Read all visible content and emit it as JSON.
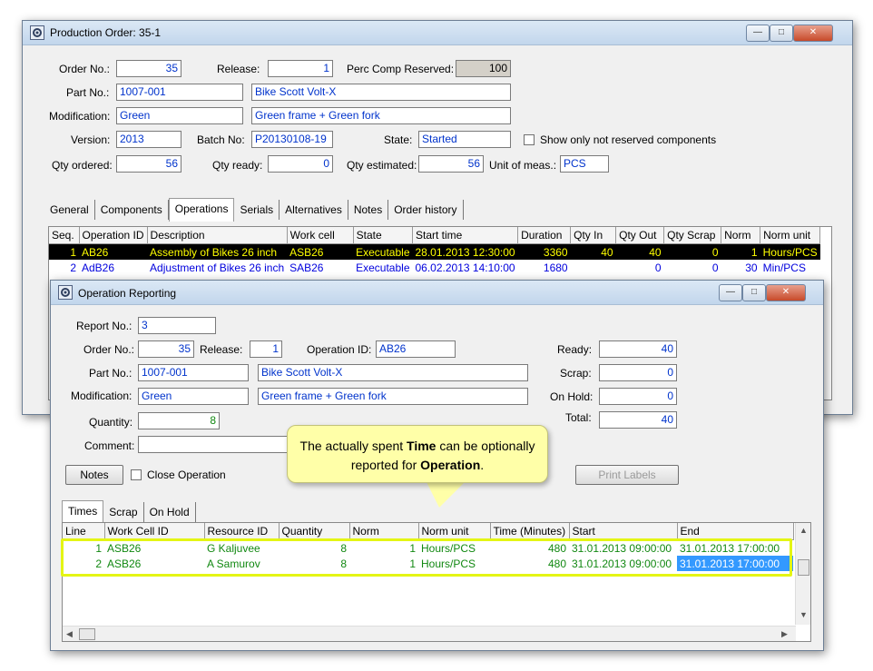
{
  "main_window": {
    "title": "Production Order: 35-1",
    "form": {
      "order_no_label": "Order No.:",
      "order_no": "35",
      "release_label": "Release:",
      "release": "1",
      "perc_comp_label": "Perc Comp Reserved:",
      "perc_comp": "100",
      "part_no_label": "Part No.:",
      "part_no": "1007-001",
      "part_desc": "Bike Scott Volt-X",
      "modification_label": "Modification:",
      "modification": "Green",
      "modification_desc": "Green frame + Green fork",
      "version_label": "Version:",
      "version": "2013",
      "batch_label": "Batch No:",
      "batch": "P20130108-19",
      "state_label": "State:",
      "state": "Started",
      "show_only_label": "Show only not reserved components",
      "qty_ordered_label": "Qty ordered:",
      "qty_ordered": "56",
      "qty_ready_label": "Qty ready:",
      "qty_ready": "0",
      "qty_estimated_label": "Qty estimated:",
      "qty_estimated": "56",
      "unit_label": "Unit of meas.:",
      "unit": "PCS"
    },
    "tabs": [
      "General",
      "Components",
      "Operations",
      "Serials",
      "Alternatives",
      "Notes",
      "Order history"
    ],
    "active_tab": "Operations",
    "ops_columns": [
      "Seq.",
      "Operation ID",
      "Description",
      "Work cell",
      "State",
      "Start time",
      "Duration",
      "Qty In",
      "Qty Out",
      "Qty Scrap",
      "Norm",
      "Norm unit"
    ],
    "ops_rows": [
      [
        "1",
        "AB26",
        "Assembly of Bikes 26 inch",
        "ASB26",
        "Executable",
        "28.01.2013 12:30:00",
        "3360",
        "40",
        "40",
        "0",
        "1",
        "Hours/PCS"
      ],
      [
        "2",
        "AdB26",
        "Adjustment of Bikes 26 inch",
        "SAB26",
        "Executable",
        "06.02.2013 14:10:00",
        "1680",
        "",
        "0",
        "0",
        "30",
        "Min/PCS"
      ]
    ]
  },
  "report_window": {
    "title": "Operation Reporting",
    "form": {
      "report_no_label": "Report No.:",
      "report_no": "3",
      "order_no_label": "Order No.:",
      "order_no": "35",
      "release_label": "Release:",
      "release": "1",
      "operation_id_label": "Operation ID:",
      "operation_id": "AB26",
      "part_no_label": "Part No.:",
      "part_no": "1007-001",
      "part_desc": "Bike Scott Volt-X",
      "modification_label": "Modification:",
      "modification": "Green",
      "modification_desc": "Green frame + Green fork",
      "quantity_label": "Quantity:",
      "quantity": "8",
      "comment_label": "Comment:",
      "comment": "",
      "ready_label": "Ready:",
      "ready": "40",
      "scrap_label": "Scrap:",
      "scrap": "0",
      "onhold_label": "On Hold:",
      "onhold": "0",
      "total_label": "Total:",
      "total": "40",
      "notes_button": "Notes",
      "close_operation_label": "Close Operation",
      "print_labels_button": "Print Labels"
    },
    "tabs": [
      "Times",
      "Scrap",
      "On Hold"
    ],
    "active_tab": "Times",
    "times_columns": [
      "Line",
      "Work Cell ID",
      "Resource ID",
      "Quantity",
      "Norm",
      "Norm unit",
      "Time (Minutes)",
      "Start",
      "End"
    ],
    "times_rows": [
      [
        "1",
        "ASB26",
        "G Kaljuvee",
        "8",
        "1",
        "Hours/PCS",
        "480",
        "31.01.2013 09:00:00",
        "31.01.2013 17:00:00"
      ],
      [
        "2",
        "ASB26",
        "A Samurov",
        "8",
        "1",
        "Hours/PCS",
        "480",
        "31.01.2013 09:00:00",
        "31.01.2013 17:00:00"
      ]
    ]
  },
  "callout": {
    "text_a": "The actually spent ",
    "bold_a": "Time",
    "text_b": " can be optionally reported for ",
    "bold_b": "Operation",
    "text_c": "."
  },
  "colors": {
    "highlight": "#e4f514",
    "selected_row_bg": "#000000",
    "selected_row_fg": "#ffff00",
    "value_blue": "#0033cc",
    "value_green": "#118811"
  },
  "icons": [
    "gear-icon",
    "minimize-icon",
    "maximize-icon",
    "close-icon"
  ]
}
